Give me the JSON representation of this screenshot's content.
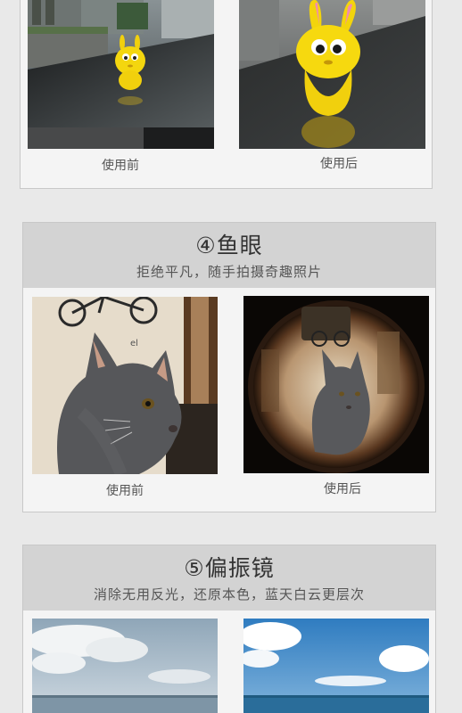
{
  "top_section": {
    "before_caption": "使用前",
    "after_caption": "使用后"
  },
  "fisheye_section": {
    "title": "④鱼眼",
    "subtitle": "拒绝平凡，随手拍摄奇趣照片",
    "before_caption": "使用前",
    "after_caption": "使用后"
  },
  "polarizer_section": {
    "title": "⑤偏振镜",
    "subtitle": "消除无用反光，还原本色，蓝天白云更层次"
  },
  "colors": {
    "background": "#e9e9e9",
    "card_header": "#d3d3d3",
    "card_border": "#c8c8c8"
  }
}
